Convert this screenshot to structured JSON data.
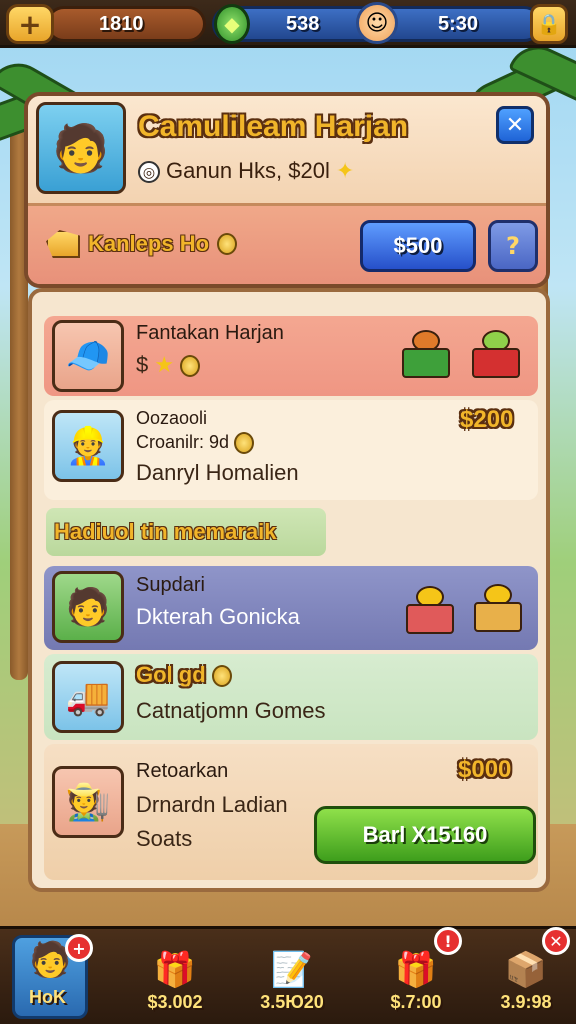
{
  "topbar": {
    "coins": "1810",
    "gems": "538",
    "timer": "5:30"
  },
  "profile": {
    "name": "Camulileam Harjan",
    "subtitle": "Ganun Hks, $20l",
    "rank_label": "Kanleps Ho",
    "price_button": "$500",
    "help_button": "?"
  },
  "list": {
    "row1": {
      "title": "Fantakan Harjan",
      "sub": "$"
    },
    "row2": {
      "price": "$200",
      "line1": "Oozaooli",
      "line2": "Croanilr: 9d",
      "line3": "Danryl Homalien"
    },
    "section_label": "Hadiuol tin memaraik",
    "row3": {
      "title": "Supdari",
      "sub": "Dkterah Gonicka"
    },
    "row4": {
      "title": "Gol gd",
      "sub": "Catnatjomn Gomes"
    },
    "row5": {
      "price": "$000",
      "title": "Retoarkan",
      "line2": "Drnardn Ladian",
      "line3": "Soats",
      "buy_button": "Barl X15160"
    }
  },
  "bottombar": {
    "items": [
      {
        "label": "HoK",
        "icon": "profile-icon"
      },
      {
        "label": "$3.002",
        "icon": "gift-icon"
      },
      {
        "label": "3.5Ю20",
        "icon": "notepad-icon"
      },
      {
        "label": "$.7:00",
        "icon": "gift-icon"
      },
      {
        "label": "3.9:98",
        "icon": "chest-icon"
      }
    ]
  },
  "colors": {
    "accent_gold": "#f1b52a",
    "brand_blue": "#2650c9",
    "buy_green": "#3e9e1c",
    "badge_red": "#e63030"
  }
}
